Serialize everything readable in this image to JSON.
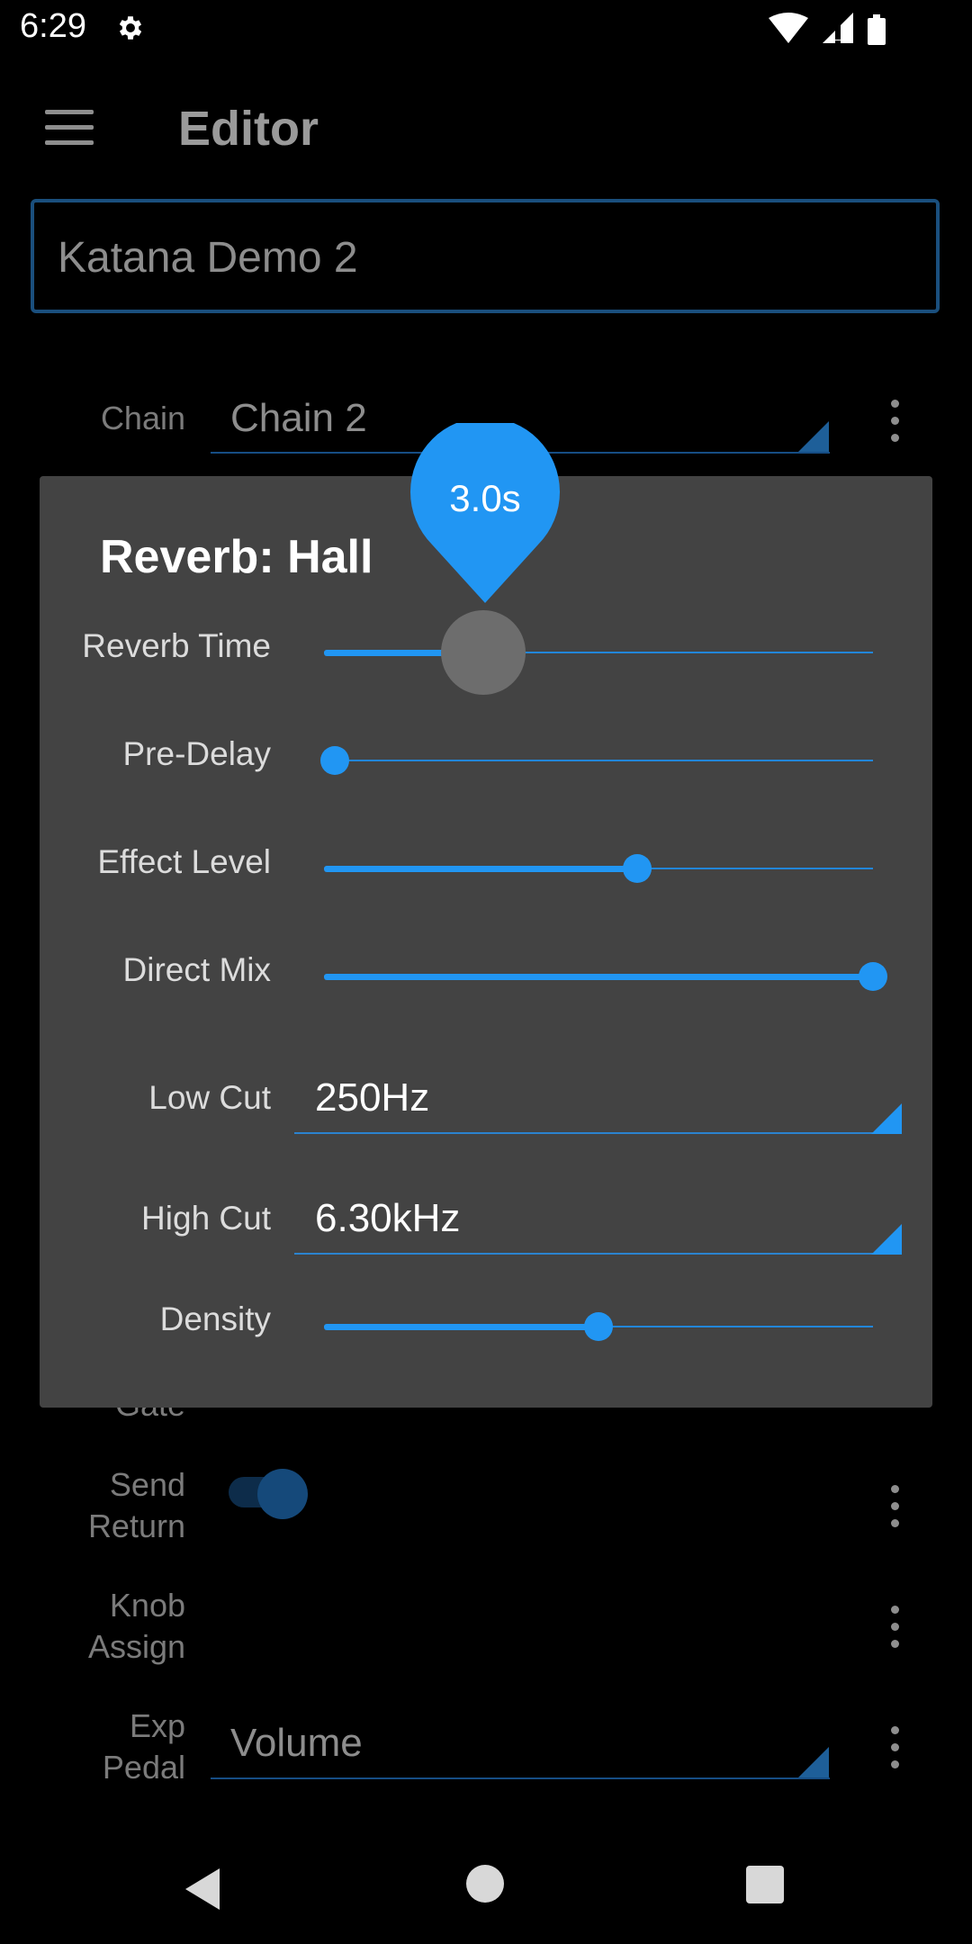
{
  "status_bar": {
    "time": "6:29",
    "icons": [
      "gear-icon",
      "wifi-icon",
      "signal-icon",
      "battery-icon"
    ]
  },
  "app_bar": {
    "title": "Editor"
  },
  "patch_name": "Katana Demo 2",
  "background_rows": {
    "chain": {
      "label": "Chain",
      "value": "Chain 2"
    },
    "gate": {
      "label": "Gate"
    },
    "send_return": {
      "label_line1": "Send",
      "label_line2": "Return",
      "enabled": true
    },
    "knob_assign": {
      "label_line1": "Knob",
      "label_line2": "Assign"
    },
    "exp_pedal": {
      "label_line1": "Exp",
      "label_line2": "Pedal",
      "value": "Volume"
    }
  },
  "dialog": {
    "title": "Reverb: Hall",
    "sliders": [
      {
        "label": "Reverb Time",
        "fraction": 0.29,
        "active": true,
        "tooltip": "3.0s"
      },
      {
        "label": "Pre-Delay",
        "fraction": 0.02
      },
      {
        "label": "Effect Level",
        "fraction": 0.57
      },
      {
        "label": "Direct Mix",
        "fraction": 1.0
      },
      {
        "label": "Density",
        "fraction": 0.5
      }
    ],
    "low_cut": {
      "label": "Low Cut",
      "value": "250Hz"
    },
    "high_cut": {
      "label": "High Cut",
      "value": "6.30kHz"
    }
  },
  "colors": {
    "accent": "#2196f3",
    "dialog_bg": "#434343",
    "field_border": "#1a4f7d"
  }
}
